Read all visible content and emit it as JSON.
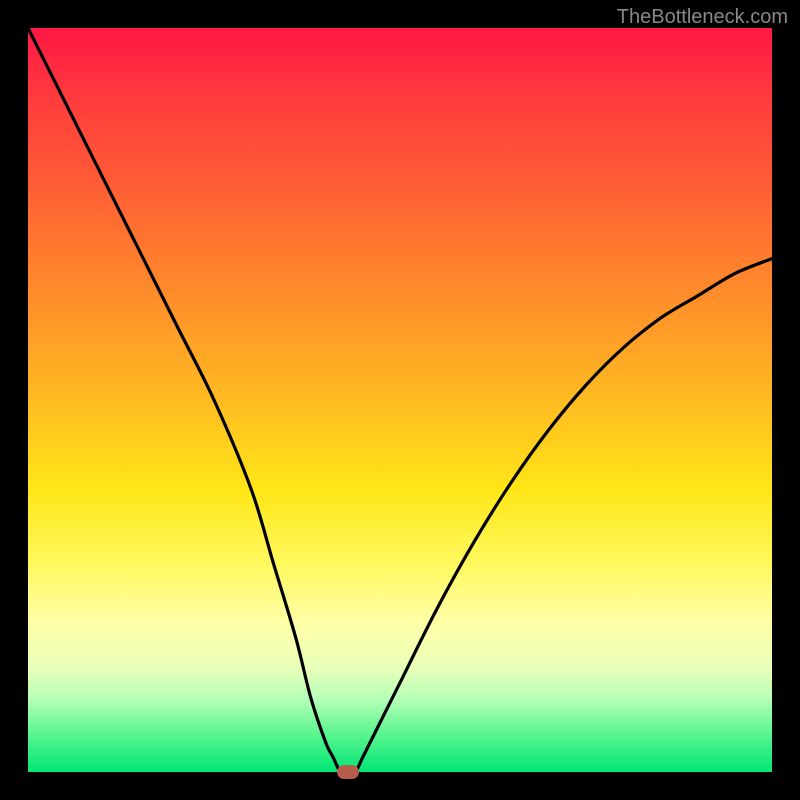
{
  "watermark": "TheBottleneck.com",
  "chart_data": {
    "type": "line",
    "title": "",
    "xlabel": "",
    "ylabel": "",
    "xlim": [
      0,
      100
    ],
    "ylim": [
      0,
      100
    ],
    "series": [
      {
        "name": "bottleneck-curve",
        "x": [
          0,
          5,
          10,
          15,
          20,
          25,
          30,
          33,
          36,
          38,
          40,
          41,
          42,
          43,
          44,
          45,
          47,
          50,
          55,
          60,
          65,
          70,
          75,
          80,
          85,
          90,
          95,
          100
        ],
        "y": [
          100,
          90,
          80,
          70,
          60,
          50,
          38,
          28,
          18,
          10,
          4,
          2,
          0,
          0,
          0,
          2,
          6,
          12,
          22,
          31,
          39,
          46,
          52,
          57,
          61,
          64,
          67,
          69
        ]
      }
    ],
    "marker": {
      "x": 43,
      "y": 0,
      "color": "#b85c4a"
    },
    "background_gradient": {
      "top": "#ff1744",
      "mid": "#ffe617",
      "bottom": "#00e676"
    }
  }
}
